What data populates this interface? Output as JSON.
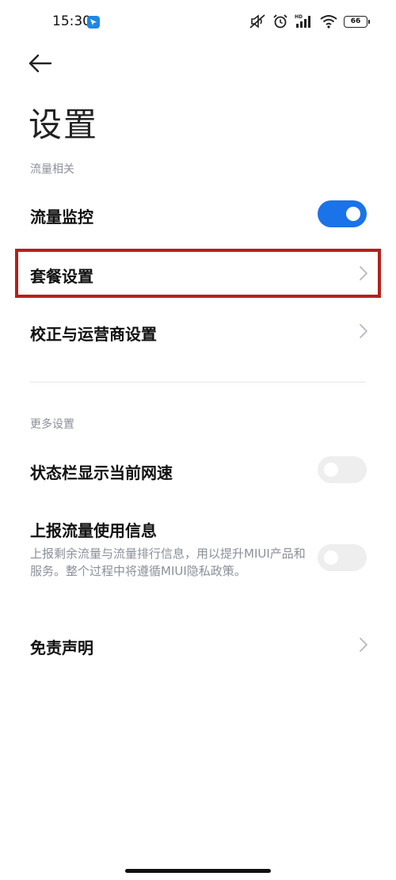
{
  "status_bar": {
    "time": "15:30",
    "battery": "66",
    "icons": [
      "mute-icon",
      "alarm-icon",
      "hd-signal-icon",
      "wifi-icon",
      "battery-icon"
    ]
  },
  "header": {
    "title": "设置"
  },
  "sections": {
    "traffic": {
      "label": "流量相关",
      "items": [
        {
          "label": "流量监控",
          "control": "toggle",
          "state": "on"
        },
        {
          "label": "套餐设置",
          "control": "chevron"
        },
        {
          "label": "校正与运营商设置",
          "control": "chevron"
        }
      ]
    },
    "more": {
      "label": "更多设置",
      "items": [
        {
          "label": "状态栏显示当前网速",
          "control": "toggle",
          "state": "off"
        },
        {
          "label": "上报流量使用信息",
          "description": "上报剩余流量与流量排行信息，用以提升MIUI产品和服务。整个过程中将遵循MIUI隐私政策。",
          "control": "toggle",
          "state": "off"
        },
        {
          "label": "免责声明",
          "control": "chevron"
        }
      ]
    }
  },
  "colors": {
    "accent": "#1a73e8",
    "highlight": "#b5201a",
    "secondary_text": "#8b8f99"
  }
}
